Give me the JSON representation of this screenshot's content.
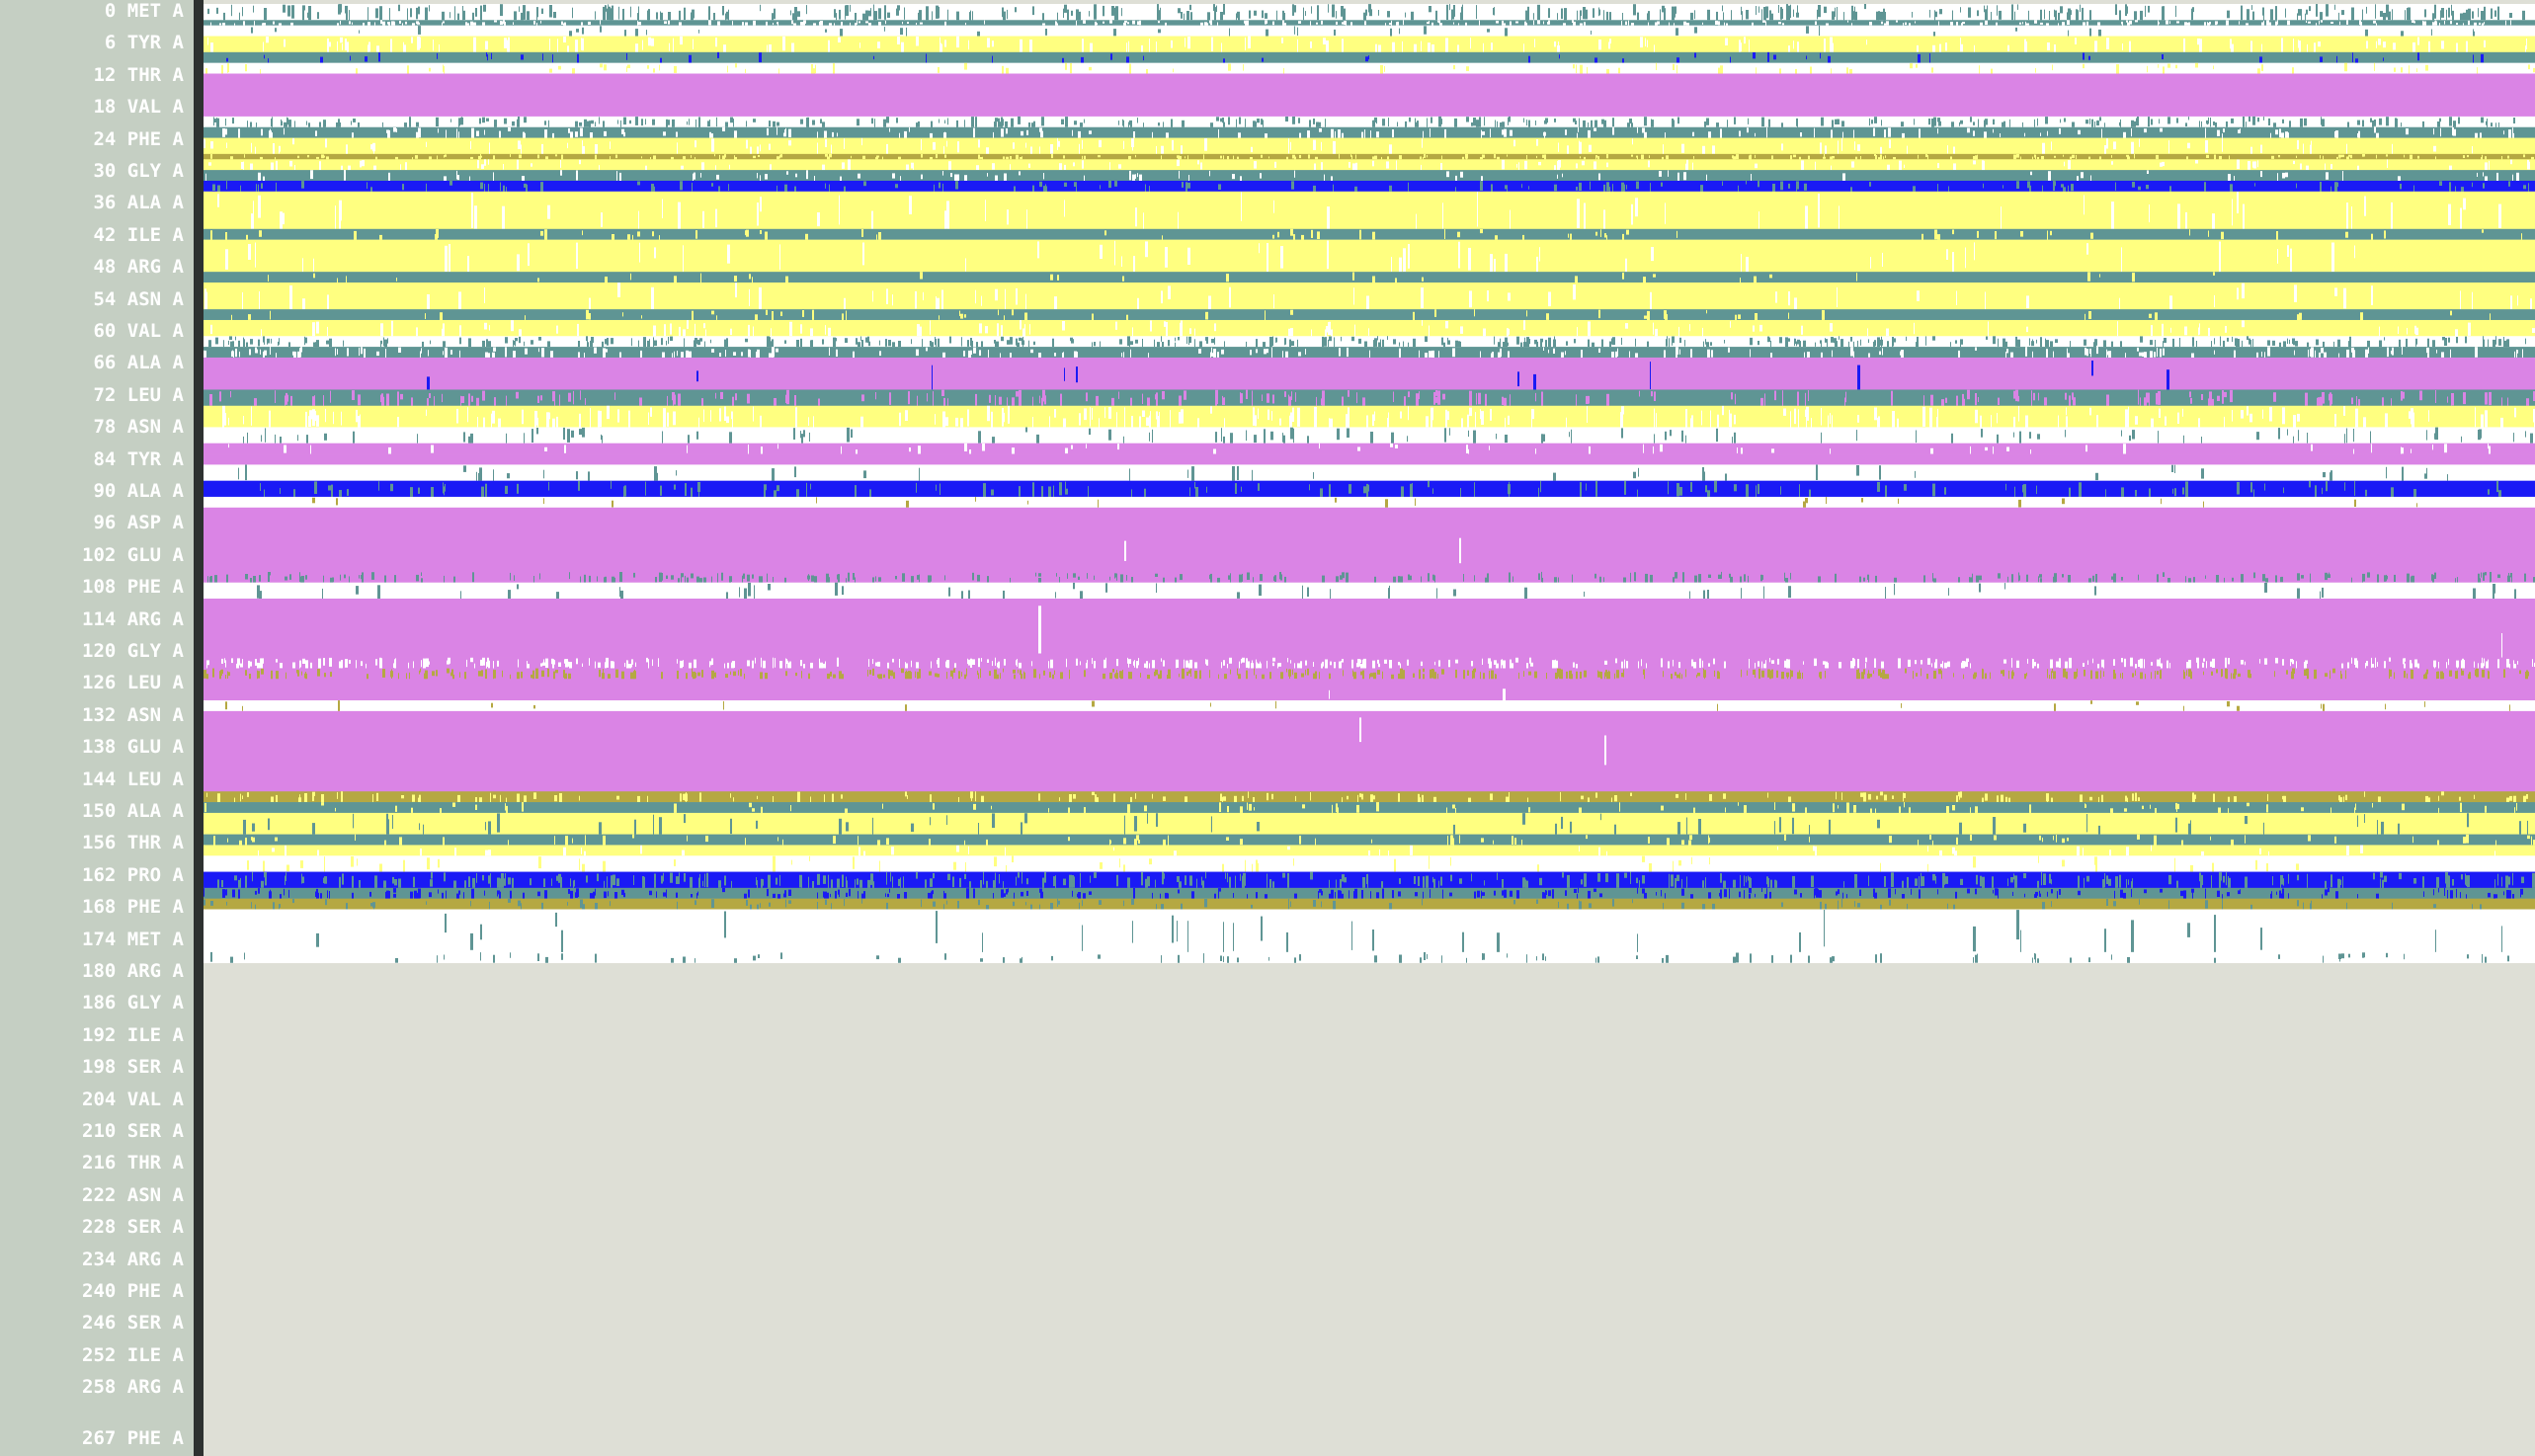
{
  "residues": [
    {
      "label": "0 MET A",
      "row": 0
    },
    {
      "label": "6 TYR A",
      "row": 1
    },
    {
      "label": "12 THR A",
      "row": 2
    },
    {
      "label": "18 VAL A",
      "row": 3
    },
    {
      "label": "24 PHE A",
      "row": 4
    },
    {
      "label": "30 GLY A",
      "row": 5
    },
    {
      "label": "36 ALA A",
      "row": 6
    },
    {
      "label": "42 ILE A",
      "row": 7
    },
    {
      "label": "48 ARG A",
      "row": 8
    },
    {
      "label": "54 ASN A",
      "row": 9
    },
    {
      "label": "60 VAL A",
      "row": 10
    },
    {
      "label": "66 ALA A",
      "row": 11
    },
    {
      "label": "72 LEU A",
      "row": 12
    },
    {
      "label": "78 ASN A",
      "row": 13
    },
    {
      "label": "84 TYR A",
      "row": 14
    },
    {
      "label": "90 ALA A",
      "row": 15
    },
    {
      "label": "96 ASP A",
      "row": 16
    },
    {
      "label": "102 GLU A",
      "row": 17
    },
    {
      "label": "108 PHE A",
      "row": 18
    },
    {
      "label": "114 ARG A",
      "row": 19
    },
    {
      "label": "120 GLY A",
      "row": 20
    },
    {
      "label": "126 LEU A",
      "row": 21
    },
    {
      "label": "132 ASN A",
      "row": 22
    },
    {
      "label": "138 GLU A",
      "row": 23
    },
    {
      "label": "144 LEU A",
      "row": 24
    },
    {
      "label": "150 ALA A",
      "row": 25
    },
    {
      "label": "156 THR A",
      "row": 26
    },
    {
      "label": "162 PRO A",
      "row": 27
    },
    {
      "label": "168 PHE A",
      "row": 28
    },
    {
      "label": "174 MET A",
      "row": 29
    },
    {
      "label": "180 ARG A",
      "row": 30
    },
    {
      "label": "186 GLY A",
      "row": 31
    },
    {
      "label": "192 ILE A",
      "row": 32
    },
    {
      "label": "198 SER A",
      "row": 33
    },
    {
      "label": "204 VAL A",
      "row": 34
    },
    {
      "label": "210 SER A",
      "row": 35
    },
    {
      "label": "216 THR A",
      "row": 36
    },
    {
      "label": "222 ASN A",
      "row": 37
    },
    {
      "label": "228 SER A",
      "row": 38
    },
    {
      "label": "234 ARG A",
      "row": 39
    },
    {
      "label": "240 PHE A",
      "row": 40
    },
    {
      "label": "246 SER A",
      "row": 41
    },
    {
      "label": "252 ILE A",
      "row": 42
    },
    {
      "label": "258 ARG A",
      "row": 43
    },
    {
      "label": "267 PHE A",
      "row": 44.6
    }
  ],
  "residue_range": [
    0,
    267
  ],
  "ss_colors": {
    "coil": "#ffffff",
    "turn": "#5f9594",
    "bend": "#ffff80",
    "helix": "#da84e5",
    "strand": "#b5a842",
    "three10": "#1a1af5",
    "bridge": "#d2cbc4"
  },
  "chart_data": {
    "type": "heatmap",
    "rows_axis": "residue",
    "columns_axis": "frame",
    "bands": [
      {
        "from": 0,
        "to": 3,
        "state": "coil",
        "noise": "turn",
        "density": 0.35
      },
      {
        "from": 3,
        "to": 4,
        "state": "turn",
        "noise": "coil",
        "density": 0.25
      },
      {
        "from": 4,
        "to": 6,
        "state": "coil",
        "noise": "turn",
        "density": 0.04
      },
      {
        "from": 6,
        "to": 9,
        "state": "bend",
        "noise": "coil",
        "density": 0.15
      },
      {
        "from": 9,
        "to": 11,
        "state": "turn",
        "noise": "three10",
        "density": 0.05
      },
      {
        "from": 11,
        "to": 13,
        "state": "coil",
        "noise": "bend",
        "density": 0.08
      },
      {
        "from": 13,
        "to": 21,
        "state": "helix",
        "noise": "helix",
        "density": 0
      },
      {
        "from": 21,
        "to": 23,
        "state": "coil",
        "noise": "turn",
        "density": 0.3
      },
      {
        "from": 23,
        "to": 25,
        "state": "turn",
        "noise": "coil",
        "density": 0.15
      },
      {
        "from": 25,
        "to": 28,
        "state": "bend",
        "noise": "coil",
        "density": 0.1
      },
      {
        "from": 28,
        "to": 29,
        "state": "strand",
        "noise": "bend",
        "density": 0.2
      },
      {
        "from": 29,
        "to": 31,
        "state": "bend",
        "noise": "coil",
        "density": 0.1
      },
      {
        "from": 31,
        "to": 33,
        "state": "turn",
        "noise": "coil",
        "density": 0.08
      },
      {
        "from": 33,
        "to": 35,
        "state": "three10",
        "noise": "turn",
        "density": 0.12
      },
      {
        "from": 35,
        "to": 42,
        "state": "bend",
        "noise": "coil",
        "density": 0.06
      },
      {
        "from": 42,
        "to": 44,
        "state": "turn",
        "noise": "bend",
        "density": 0.06
      },
      {
        "from": 44,
        "to": 50,
        "state": "bend",
        "noise": "coil",
        "density": 0.05
      },
      {
        "from": 50,
        "to": 52,
        "state": "turn",
        "noise": "bend",
        "density": 0.03
      },
      {
        "from": 52,
        "to": 57,
        "state": "bend",
        "noise": "coil",
        "density": 0.06
      },
      {
        "from": 57,
        "to": 59,
        "state": "turn",
        "noise": "bend",
        "density": 0.05
      },
      {
        "from": 59,
        "to": 62,
        "state": "bend",
        "noise": "coil",
        "density": 0.1
      },
      {
        "from": 62,
        "to": 64,
        "state": "coil",
        "noise": "turn",
        "density": 0.35
      },
      {
        "from": 64,
        "to": 66,
        "state": "turn",
        "noise": "coil",
        "density": 0.2
      },
      {
        "from": 66,
        "to": 72,
        "state": "helix",
        "noise": "three10",
        "density": 0.01
      },
      {
        "from": 72,
        "to": 75,
        "state": "turn",
        "noise": "helix",
        "density": 0.2
      },
      {
        "from": 75,
        "to": 79,
        "state": "bend",
        "noise": "coil",
        "density": 0.2
      },
      {
        "from": 79,
        "to": 82,
        "state": "coil",
        "noise": "turn",
        "density": 0.1
      },
      {
        "from": 82,
        "to": 84,
        "state": "helix",
        "noise": "coil",
        "density": 0.05
      },
      {
        "from": 84,
        "to": 86,
        "state": "helix",
        "noise": "helix",
        "density": 0
      },
      {
        "from": 86,
        "to": 89,
        "state": "coil",
        "noise": "turn",
        "density": 0.04
      },
      {
        "from": 89,
        "to": 92,
        "state": "three10",
        "noise": "turn",
        "density": 0.12
      },
      {
        "from": 92,
        "to": 94,
        "state": "coil",
        "noise": "strand",
        "density": 0.02
      },
      {
        "from": 94,
        "to": 106,
        "state": "helix",
        "noise": "coil",
        "density": 0.002
      },
      {
        "from": 106,
        "to": 108,
        "state": "helix",
        "noise": "turn",
        "density": 0.25
      },
      {
        "from": 108,
        "to": 111,
        "state": "coil",
        "noise": "turn",
        "density": 0.05
      },
      {
        "from": 111,
        "to": 122,
        "state": "helix",
        "noise": "coil",
        "density": 0.002
      },
      {
        "from": 122,
        "to": 124,
        "state": "helix",
        "noise": "coil",
        "density": 0.4
      },
      {
        "from": 124,
        "to": 126,
        "state": "helix",
        "noise": "strand",
        "density": 0.4
      },
      {
        "from": 126,
        "to": 130,
        "state": "helix",
        "noise": "coil",
        "density": 0.002
      },
      {
        "from": 130,
        "to": 132,
        "state": "coil",
        "noise": "strand",
        "density": 0.02
      },
      {
        "from": 132,
        "to": 147,
        "state": "helix",
        "noise": "coil",
        "density": 0.002
      },
      {
        "from": 147,
        "to": 149,
        "state": "strand",
        "noise": "bend",
        "density": 0.15
      },
      {
        "from": 149,
        "to": 151,
        "state": "turn",
        "noise": "bend",
        "density": 0.08
      },
      {
        "from": 151,
        "to": 155,
        "state": "bend",
        "noise": "turn",
        "density": 0.06
      },
      {
        "from": 155,
        "to": 157,
        "state": "turn",
        "noise": "bend",
        "density": 0.08
      },
      {
        "from": 157,
        "to": 159,
        "state": "bend",
        "noise": "coil",
        "density": 0.04
      },
      {
        "from": 159,
        "to": 162,
        "state": "coil",
        "noise": "bend",
        "density": 0.05
      },
      {
        "from": 162,
        "to": 165,
        "state": "three10",
        "noise": "turn",
        "density": 0.3
      },
      {
        "from": 165,
        "to": 167,
        "state": "turn",
        "noise": "three10",
        "density": 0.25
      },
      {
        "from": 167,
        "to": 169,
        "state": "strand",
        "noise": "turn",
        "density": 0.1
      },
      {
        "from": 169,
        "to": 177,
        "state": "coil",
        "noise": "turn",
        "density": 0.03
      },
      {
        "from": 177,
        "to": 179,
        "state": "coil",
        "noise": "turn",
        "density": 0.08
      }
    ]
  }
}
